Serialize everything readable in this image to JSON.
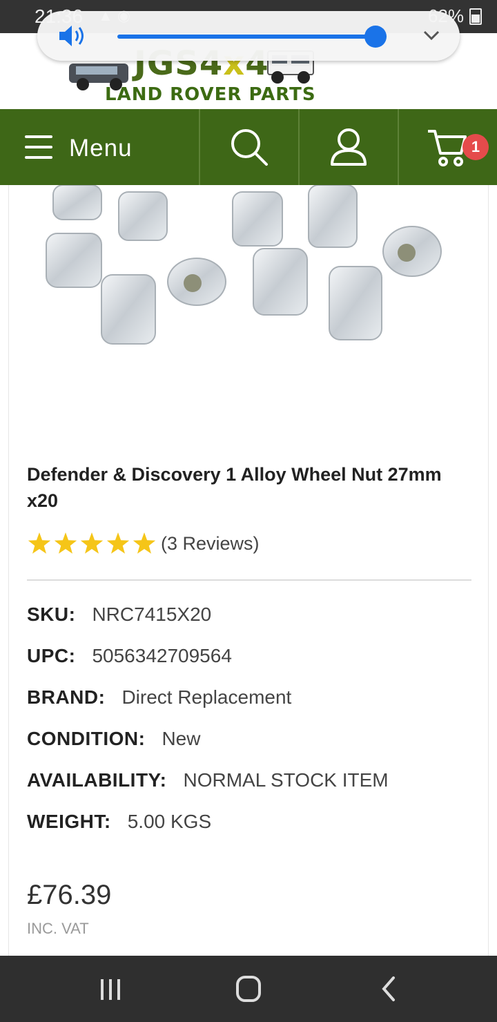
{
  "status_bar": {
    "time": "21:36",
    "battery": "62%"
  },
  "volume": {
    "level_percent": 100
  },
  "logo": {
    "brand_a": "JGS4",
    "brand_x": "x",
    "brand_b": "4",
    "tagline": "LAND ROVER PARTS"
  },
  "navbar": {
    "menu_label": "Menu",
    "cart_count": "1"
  },
  "product": {
    "title": "Defender & Discovery 1 Alloy Wheel Nut 27mm x20",
    "rating": 5,
    "reviews": "(3 Reviews)",
    "specs": [
      {
        "label": "SKU:",
        "value": "NRC7415X20"
      },
      {
        "label": "UPC:",
        "value": "5056342709564"
      },
      {
        "label": "BRAND:",
        "value": "Direct Replacement"
      },
      {
        "label": "CONDITION:",
        "value": "New"
      },
      {
        "label": "AVAILABILITY:",
        "value": "NORMAL STOCK ITEM"
      },
      {
        "label": "WEIGHT:",
        "value": "5.00 KGS"
      }
    ],
    "price": "£76.39",
    "vat_note": "INC. VAT"
  },
  "colors": {
    "nav_green": "#3e6717",
    "badge_red": "#e54b4b",
    "star_yellow": "#f5c518",
    "volume_blue": "#1a73e8"
  }
}
